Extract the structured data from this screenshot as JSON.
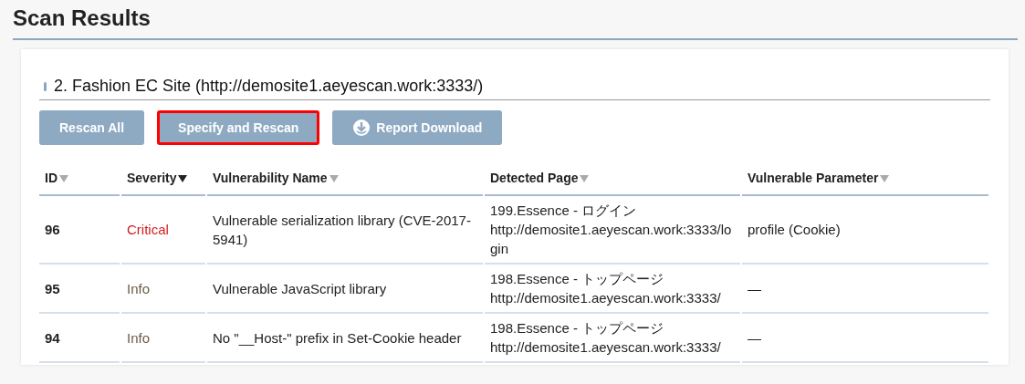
{
  "page_title": "Scan Results",
  "section_title": "2. Fashion EC Site (http://demosite1.aeyescan.work:3333/)",
  "buttons": [
    {
      "label": "Rescan All",
      "highlighted": false,
      "kind": "plain"
    },
    {
      "label": "Specify and Rescan",
      "highlighted": true,
      "kind": "plain"
    },
    {
      "label": "Report Download",
      "highlighted": false,
      "kind": "download"
    }
  ],
  "table": {
    "columns": [
      {
        "label": "ID",
        "sorted": false
      },
      {
        "label": "Severity",
        "sorted": true
      },
      {
        "label": "Vulnerability Name",
        "sorted": false
      },
      {
        "label": "Detected Page",
        "sorted": false
      },
      {
        "label": "Vulnerable Parameter",
        "sorted": false
      }
    ],
    "rows": [
      {
        "id": "96",
        "severity": "Critical",
        "color": "#d0201f",
        "name": "Vulnerable serialization library (CVE-2017-5941)",
        "page_title": "199.Essence - ログイン",
        "page_url": "http://demosite1.aeyescan.work:3333/login",
        "parameter": "profile (Cookie)"
      },
      {
        "id": "95",
        "severity": "Info",
        "color": "#6b5a48",
        "name": "Vulnerable JavaScript library",
        "page_title": "198.Essence - トップページ",
        "page_url": "http://demosite1.aeyescan.work:3333/",
        "parameter": "—"
      },
      {
        "id": "94",
        "severity": "Info",
        "color": "#6b5a48",
        "name": "No \"__Host-\" prefix in Set-Cookie header",
        "page_title": "198.Essence - トップページ",
        "page_url": "http://demosite1.aeyescan.work:3333/",
        "parameter": "—"
      }
    ]
  }
}
